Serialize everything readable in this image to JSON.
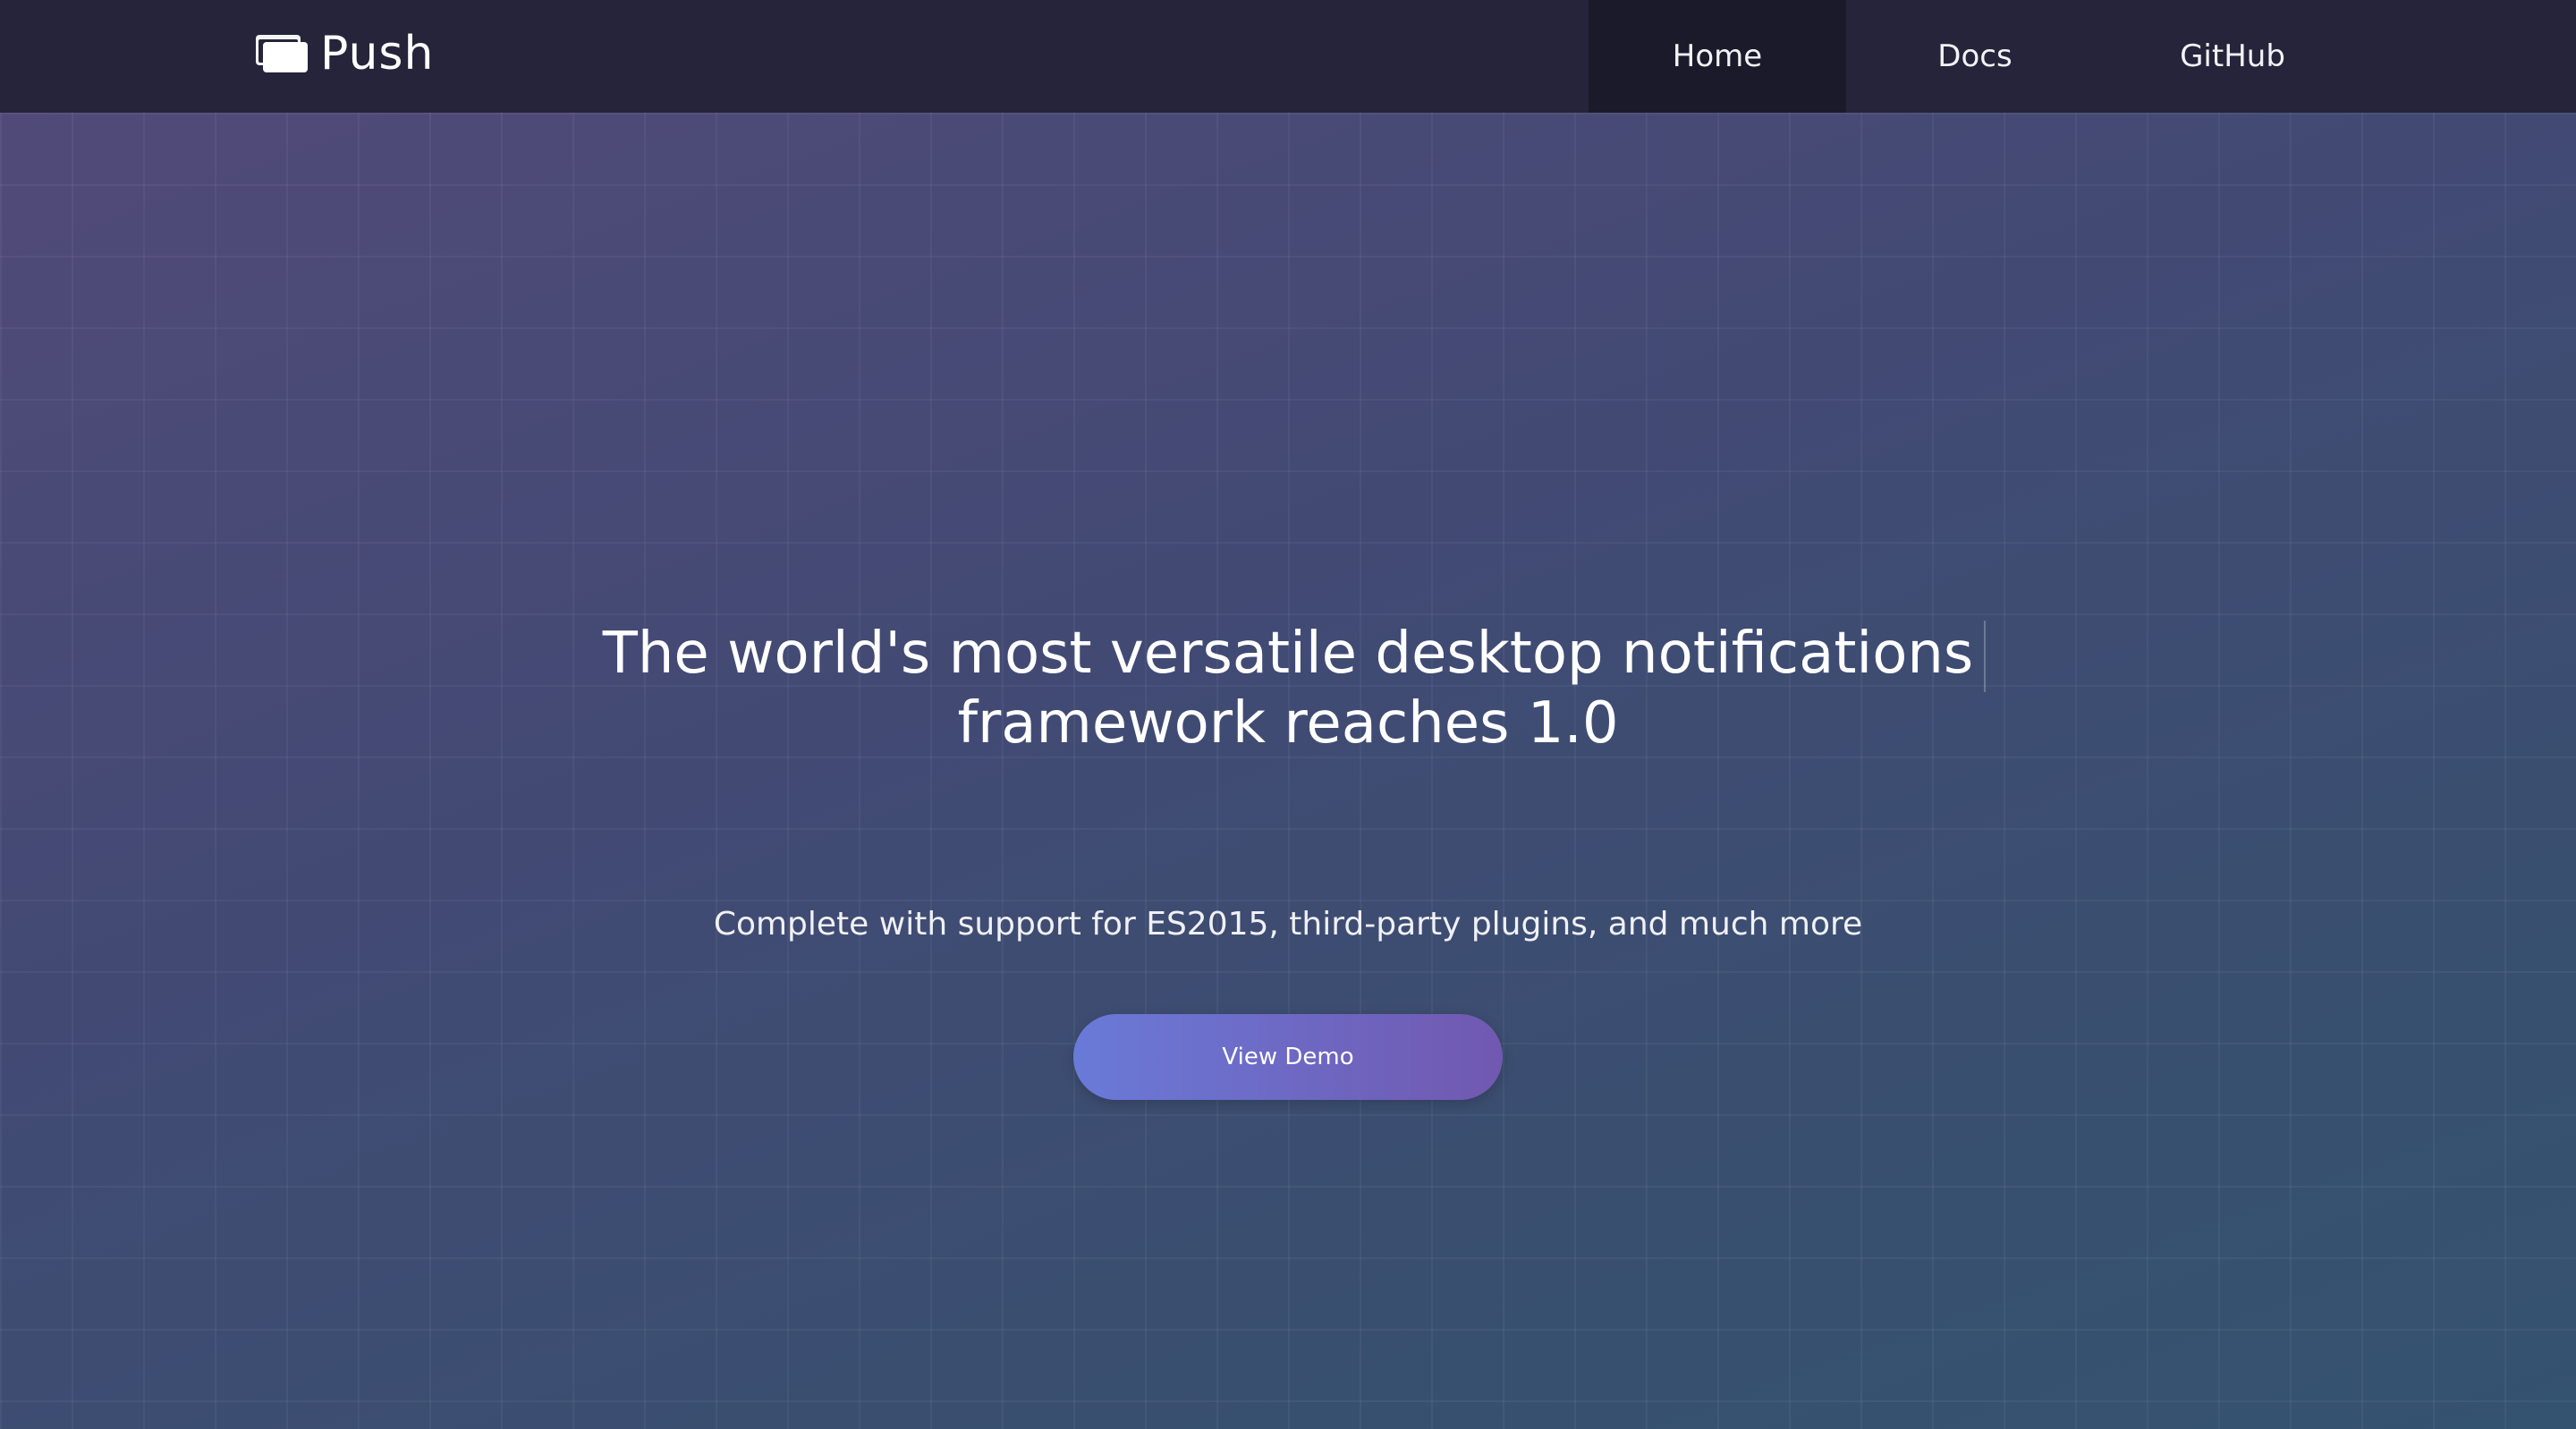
{
  "header": {
    "brand": {
      "name": "Push",
      "icon": "browser-windows-icon"
    },
    "nav": {
      "items": [
        {
          "label": "Home",
          "active": true
        },
        {
          "label": "Docs",
          "active": false
        },
        {
          "label": "GitHub",
          "active": false
        }
      ]
    }
  },
  "hero": {
    "headline_line1": "The world's most versatile desktop notifications",
    "headline_line2": "framework reaches 1.0",
    "subtitle": "Complete with support for ES2015, third-party plugins, and much more",
    "cta_label": "View Demo"
  },
  "colors": {
    "navbar": "#25243a",
    "nav_active": "#1b1a2b",
    "button_start": "#6a7ad8",
    "button_end": "#7158b0",
    "hero_top_left": "#514a78",
    "hero_bottom_right": "#345370"
  }
}
